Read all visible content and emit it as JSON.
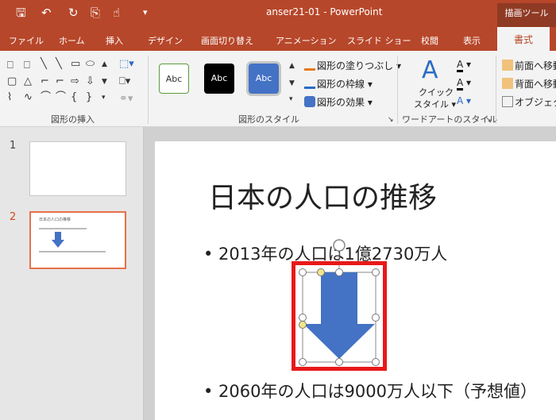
{
  "titlebar": {
    "doc_title": "anser21-01 - PowerPoint",
    "contextual_tab": "描画ツール",
    "qa_icons": [
      "save-icon",
      "undo-icon",
      "redo-icon",
      "present-icon",
      "touch-mode-icon",
      "customize-icon"
    ]
  },
  "tabs": [
    "ファイル",
    "ホーム",
    "挿入",
    "デザイン",
    "画面切り替え",
    "アニメーション",
    "スライド ショー",
    "校閲",
    "表示"
  ],
  "active_tab": "書式",
  "ribbon": {
    "insert_shapes_label": "図形の挿入",
    "shape_styles_label": "図形のスタイル",
    "wordart_label": "ワードアートのスタイル",
    "style_text": "Abc",
    "fill": "図形の塗りつぶし",
    "outline": "図形の枠線",
    "effect": "図形の効果",
    "quick_style_1": "クイック",
    "quick_style_2": "スタイル",
    "bring_forward": "前面へ移動",
    "send_backward": "背面へ移動",
    "object": "オブジェクト",
    "wordart_letter": "A"
  },
  "slides": {
    "numbers": [
      "1",
      "2"
    ],
    "thumb_title": "日本の人口の推移"
  },
  "slide": {
    "title": "日本の人口の推移",
    "bullet1": "• 2013年の人口は1億2730万人",
    "bullet2": "• 2060年の人口は9000万人以下（予想値）"
  },
  "colors": {
    "accent": "#b7472a",
    "arrow": "#4472c4",
    "selection": "#e8191a"
  }
}
